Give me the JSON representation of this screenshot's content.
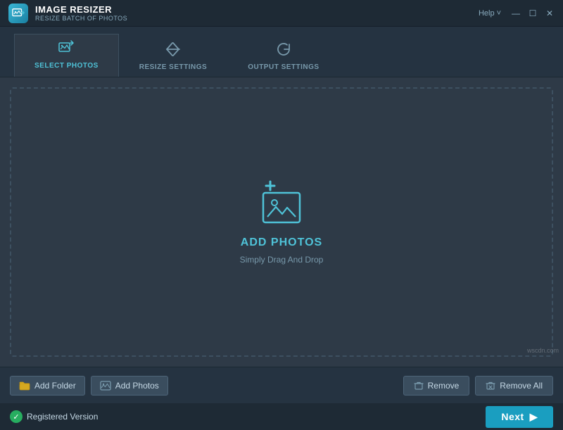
{
  "titleBar": {
    "appName": "IMAGE RESIZER",
    "appSub": "RESIZE BATCH OF PHOTOS",
    "helpLabel": "Help",
    "helpChevron": "˅",
    "minimize": "—",
    "maximize": "☐",
    "close": "✕"
  },
  "tabs": [
    {
      "id": "select",
      "label": "SELECT PHOTOS",
      "active": true
    },
    {
      "id": "resize",
      "label": "RESIZE SETTINGS",
      "active": false
    },
    {
      "id": "output",
      "label": "OUTPUT SETTINGS",
      "active": false
    }
  ],
  "dropZone": {
    "title": "ADD PHOTOS",
    "subtitle": "Simply Drag And Drop"
  },
  "bottomButtons": {
    "addFolder": "Add Folder",
    "addPhotos": "Add Photos",
    "remove": "Remove",
    "removeAll": "Remove All"
  },
  "statusBar": {
    "registeredLabel": "Registered Version",
    "nextLabel": "Next"
  },
  "watermark": "wscdn.com"
}
